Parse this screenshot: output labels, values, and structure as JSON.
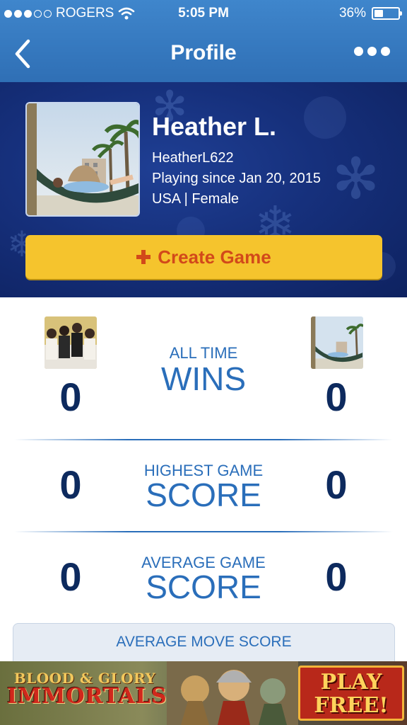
{
  "status_bar": {
    "carrier": "ROGERS",
    "time": "5:05 PM",
    "battery": "36%",
    "battery_level": 0.36,
    "signal_bars_filled": 3,
    "signal_bars_total": 5
  },
  "nav": {
    "title": "Profile",
    "back_icon": "chevron-left-icon",
    "more_icon": "more-horizontal-icon"
  },
  "profile": {
    "name": "Heather L.",
    "username": "HeatherL622",
    "since": "Playing since Jan 20, 2015",
    "location_gender": "USA | Female"
  },
  "actions": {
    "create_game": "Create Game"
  },
  "stats": [
    {
      "label_small": "ALL TIME",
      "label_big": "WINS",
      "left": "0",
      "right": "0"
    },
    {
      "label_small": "HIGHEST GAME",
      "label_big": "SCORE",
      "left": "0",
      "right": "0"
    },
    {
      "label_small": "AVERAGE GAME",
      "label_big": "SCORE",
      "left": "0",
      "right": "0"
    }
  ],
  "average_move": {
    "label": "AVERAGE MOVE SCORE"
  },
  "ad": {
    "title_line1": "BLOOD & GLORY",
    "title_line2": "IMMORTALS",
    "cta_line1": "PLAY",
    "cta_line2": "FREE!"
  },
  "colors": {
    "nav_blue": "#3479c0",
    "hero_navy": "#16307c",
    "button_yellow": "#f5c42d",
    "button_text_orange": "#d2491a",
    "stat_number": "#0d2a5e",
    "stat_label": "#2a6eba"
  }
}
